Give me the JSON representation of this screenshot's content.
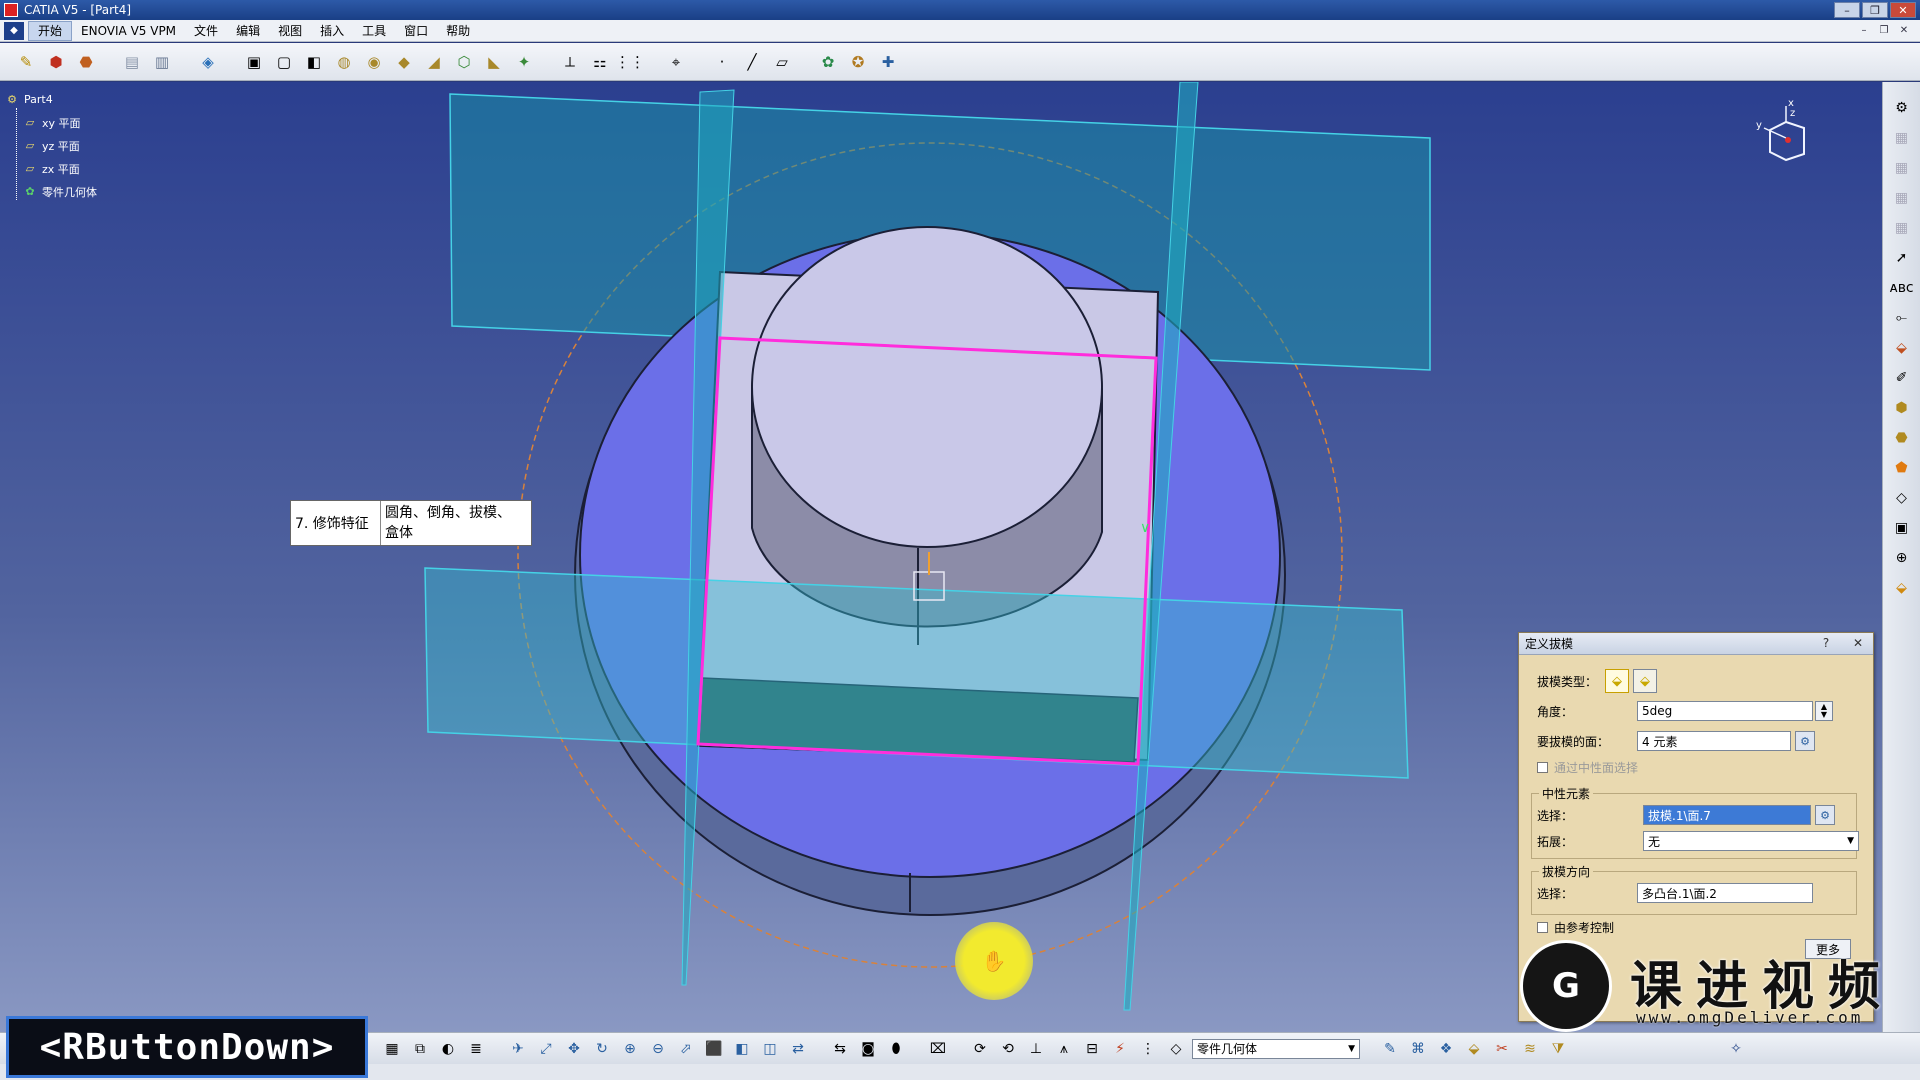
{
  "window": {
    "title": "CATIA V5 - [Part4]",
    "controls": [
      "–",
      "❐",
      "✕"
    ]
  },
  "menubar": {
    "items": [
      "开始",
      "ENOVIA V5 VPM",
      "文件",
      "编辑",
      "视图",
      "插入",
      "工具",
      "窗口",
      "帮助"
    ],
    "mdi_controls": [
      "–",
      "❐",
      "✕"
    ]
  },
  "tree": {
    "root": "Part4",
    "children": [
      "xy 平面",
      "yz 平面",
      "zx 平面",
      "零件几何体"
    ]
  },
  "compass": {
    "x_label": "x",
    "y_label": "y",
    "z_label": "z"
  },
  "annotation": {
    "step": "7. 修饰特征",
    "content_line1": "圆角、倒角、拔模、",
    "content_line2": "盒体"
  },
  "dialog": {
    "title": "定义拔模",
    "help": "?",
    "close": "✕",
    "draft_type_label": "拔模类型：",
    "angle_label": "角度：",
    "angle_value": "5deg",
    "faces_label": "要拔模的面：",
    "faces_value": "4 元素",
    "neutral_select_checkbox": "通过中性面选择",
    "neutral_group": "中性元素",
    "neutral_select_label": "选择：",
    "neutral_select_value": "拔模.1\\面.7",
    "propagation_label": "拓展：",
    "propagation_value": "无",
    "direction_group": "拔模方向",
    "direction_select_label": "选择：",
    "direction_select_value": "多凸台.1\\面.2",
    "controlled_by_ref": "由参考控制",
    "more_button": "更多"
  },
  "bottom_toolbar": {
    "body_combo": "零件几何体"
  },
  "overlay": {
    "event_text": "<RButtonDown>"
  },
  "watermark": {
    "logo": "G",
    "text": "课进视频",
    "url": "www.omgDeliver.com"
  },
  "icons": {
    "top_toolbar": [
      "sketch-icon",
      "pad-icon",
      "pocket-icon",
      "shaft-icon",
      "groove-icon",
      "hole-icon",
      "rib-icon",
      "slot-icon",
      "stiffener-icon",
      "multi-section-icon",
      "fillet-icon",
      "chamfer-icon",
      "draft-icon",
      "shell-icon",
      "thickness-icon",
      "thread-icon",
      "pattern-icon",
      "transform-icon",
      "point-icon",
      "line-icon",
      "plane-icon",
      "boolean-icon",
      "analysis-icon",
      "constraint-icon"
    ],
    "right_toolbar": [
      "select-icon",
      "text-icon",
      "measure-icon",
      "dimension-icon",
      "annotation-icon",
      "pad-icon",
      "pocket-icon",
      "material-icon",
      "body-icon",
      "part-icon",
      "axis-icon",
      "insert-icon"
    ],
    "bottom_toolbar": [
      "fly-icon",
      "fit-all-icon",
      "pan-icon",
      "rotate-icon",
      "zoom-in-icon",
      "zoom-out-icon",
      "normal-view-icon",
      "iso-view-icon",
      "shading-icon",
      "hide-icon",
      "swap-icon",
      "capture-icon",
      "refresh-icon",
      "measure-between-icon",
      "axis-system-icon",
      "scale-icon",
      "update-icon",
      "render-icon",
      "material-apply-icon"
    ]
  },
  "colors": {
    "viewport_top": "#2b3f8f",
    "selection": "#ff2ddc",
    "plane": "#39c6d8",
    "dialog_bg": "#e9d9b0"
  }
}
